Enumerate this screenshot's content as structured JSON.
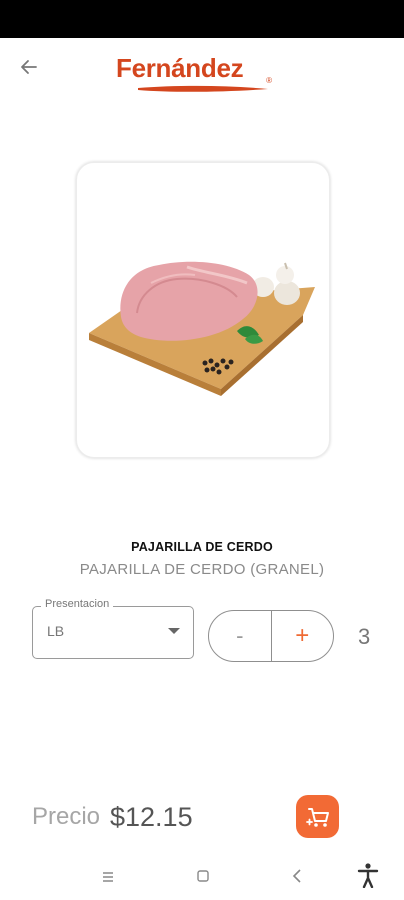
{
  "header": {
    "back_icon": "arrow-left-icon",
    "logo_text": "Fernández",
    "logo_reg": "®",
    "logo_color": "#d4461e"
  },
  "product": {
    "image_icon": "pork-on-cutting-board-image",
    "name": "PAJARILLA DE CERDO",
    "description": "PAJARILLA DE CERDO (GRANEL)"
  },
  "presentation": {
    "label": "Presentacion",
    "value": "LB"
  },
  "stepper": {
    "minus_label": "-",
    "plus_label": "+",
    "quantity": "3"
  },
  "price": {
    "label": "Precio",
    "value": "$12.15"
  },
  "cart": {
    "icon": "add-to-cart-icon",
    "color": "#f26a35"
  },
  "nav": {
    "menu_icon": "menu-icon",
    "home_icon": "home-icon",
    "back_icon": "back-icon",
    "accessibility_icon": "accessibility-icon"
  }
}
